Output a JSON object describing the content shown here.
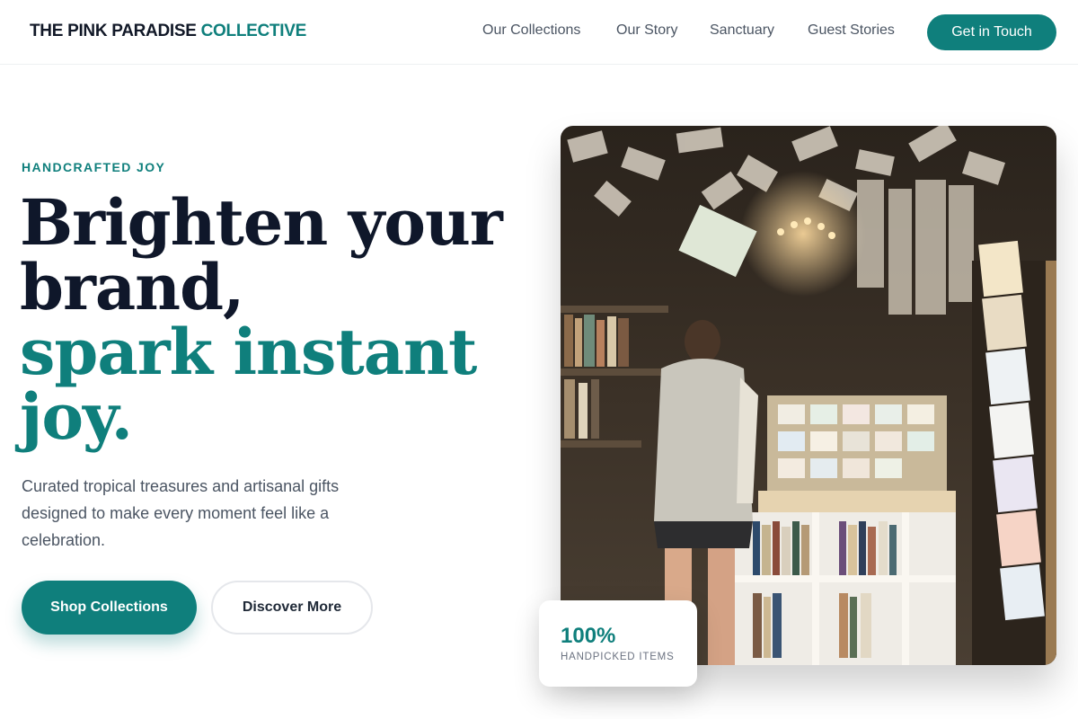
{
  "brand": {
    "name_main": "THE PINK PARADISE ",
    "name_accent": "COLLECTIVE"
  },
  "nav": {
    "items": [
      {
        "label": "Our Collections"
      },
      {
        "label": "Our Story"
      },
      {
        "label": "Sanctuary"
      },
      {
        "label": "Guest Stories"
      }
    ],
    "cta_label": "Get in Touch"
  },
  "hero": {
    "eyebrow": "HANDCRAFTED JOY",
    "headline": {
      "line1": "Brighten your",
      "line2": "brand,",
      "line3": "spark instant",
      "line4": "joy."
    },
    "subtext": "Curated tropical treasures and artisanal gifts designed to make every moment feel like a celebration.",
    "primary_button": "Shop Collections",
    "secondary_button": "Discover More",
    "image_icon": "bookshop-photo",
    "stat": {
      "value": "100%",
      "label": "HANDPICKED ITEMS"
    }
  },
  "colors": {
    "accent": "#0f7f7c",
    "heading": "#0f172a",
    "body": "#4b5563"
  }
}
